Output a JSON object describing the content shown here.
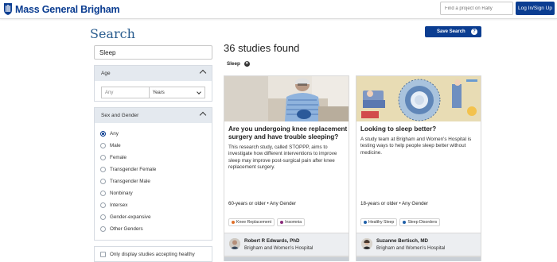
{
  "header": {
    "brand": "Mass General Brigham",
    "search_placeholder": "Find a project on Rally",
    "login_label": "Log In/Sign Up"
  },
  "page": {
    "title": "Search",
    "save_search_label": "Save Search",
    "results_count": "36 studies found",
    "active_filter": "Sleep"
  },
  "sidebar": {
    "search_value": "Sleep",
    "age": {
      "header": "Age",
      "input_placeholder": "Any",
      "unit_selected": "Years"
    },
    "sex_gender": {
      "header": "Sex and Gender",
      "options": [
        "Any",
        "Male",
        "Female",
        "Transgender Female",
        "Transgender Male",
        "Nonbinary",
        "Intersex",
        "Gender-expansive",
        "Other Genders"
      ],
      "selected": "Any"
    },
    "accepting_label": "Only display studies accepting healthy"
  },
  "cards": [
    {
      "title": "Are you undergoing knee replacement surgery and have trouble sleeping?",
      "description": "This research study, called STOPPP, aims to investigate how different interventions to improve sleep may improve post-surgical pain after knee replacement surgery.",
      "meta": "60-years or older • Any Gender",
      "tags": [
        {
          "label": "Knee Replacement",
          "color": "#e0702a"
        },
        {
          "label": "Insomnia",
          "color": "#8a2b7a"
        }
      ],
      "researcher": "Robert R Edwards, PhD",
      "organization": "Brigham and Women's Hospital"
    },
    {
      "title": "Looking to sleep better?",
      "description": "A study team at Brigham and Women's Hospital is testing ways to help people sleep better without medicine.",
      "meta": "18-years or older • Any Gender",
      "tags": [
        {
          "label": "Healthy Sleep",
          "color": "#1f5fa8"
        },
        {
          "label": "Sleep Disorders",
          "color": "#1f5fa8"
        }
      ],
      "researcher": "Suzanne Bertisch, MD",
      "organization": "Brigham and Women's Hospital"
    }
  ],
  "colors": {
    "brand_blue": "#0b3d91",
    "title_blue": "#2a5d8f",
    "panel_header": "#e4e9ef"
  }
}
